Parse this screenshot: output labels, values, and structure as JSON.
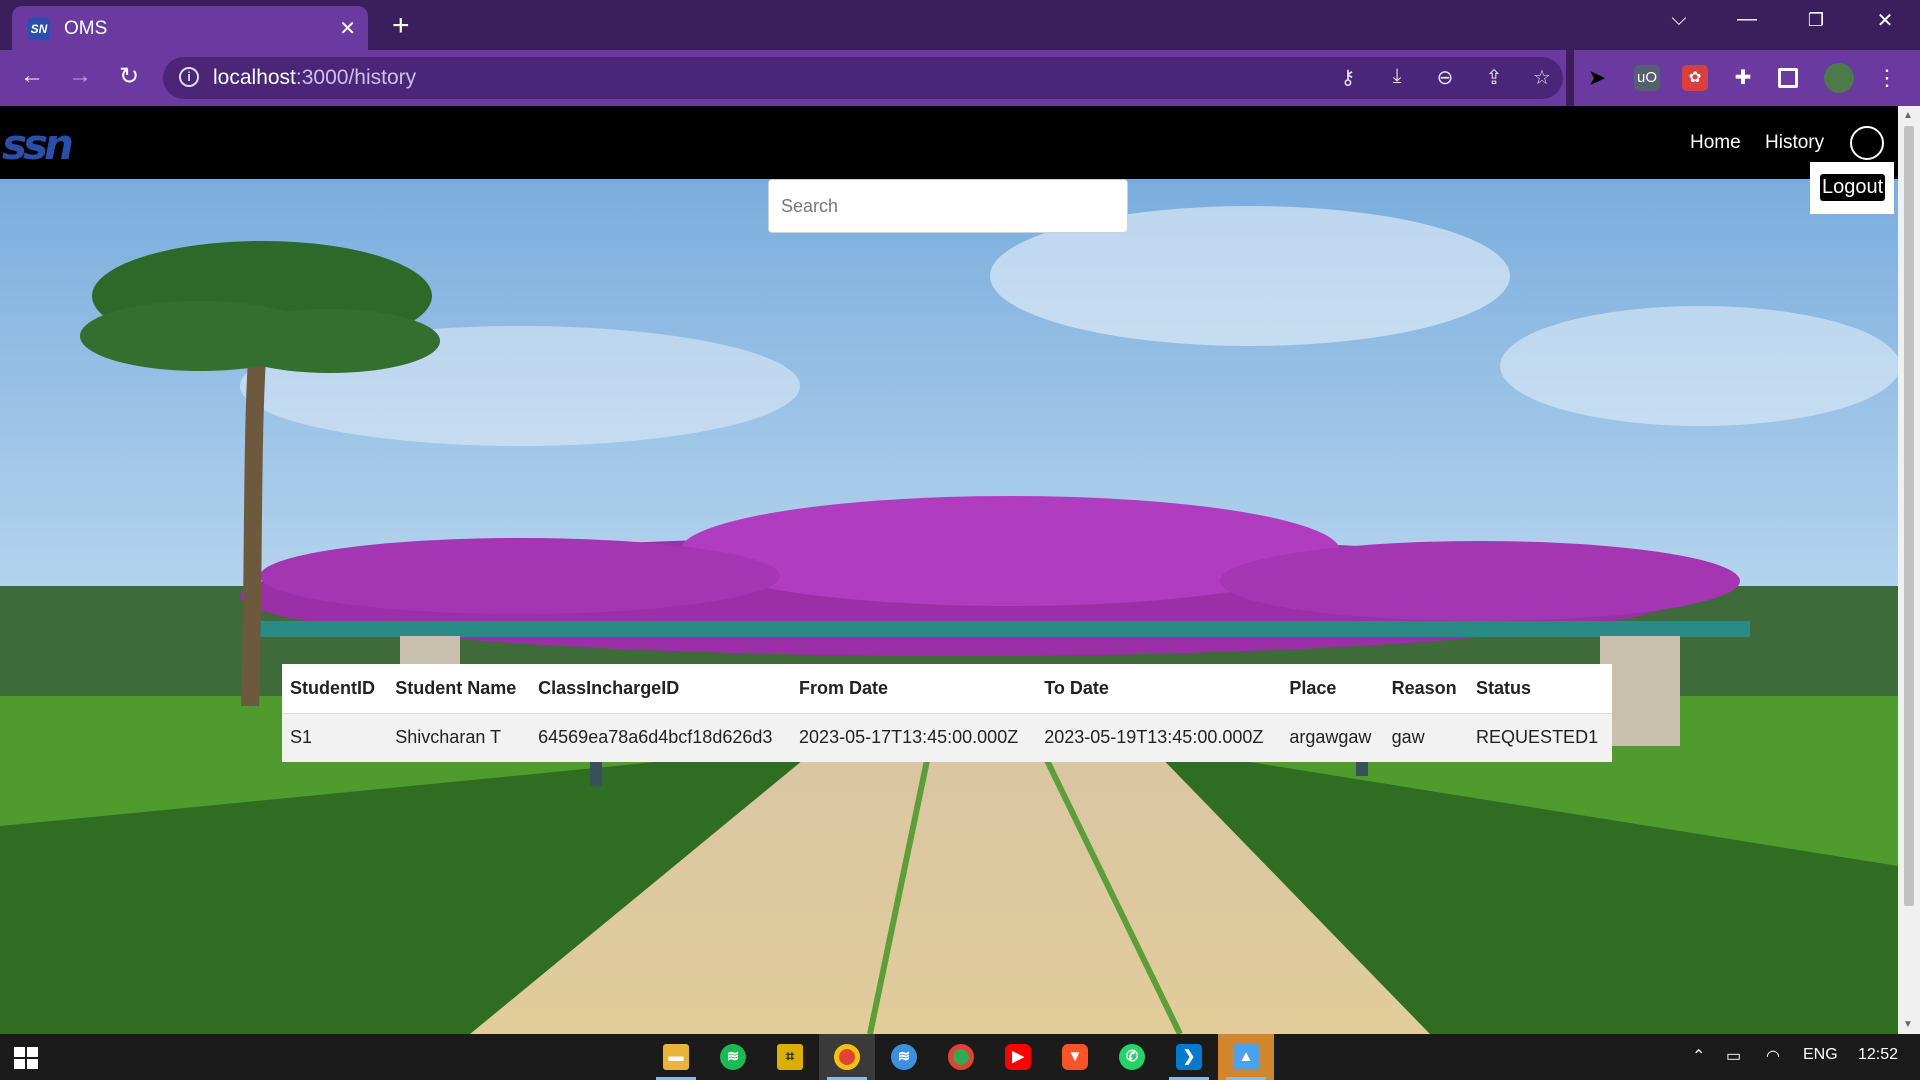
{
  "browser": {
    "tab_title": "OMS",
    "tab_close": "✕",
    "new_tab": "+",
    "url_host": "localhost",
    "url_path": ":3000/history"
  },
  "site": {
    "logo_text": "ssn",
    "nav": {
      "home": "Home",
      "history": "History"
    },
    "logout_label": "Logout"
  },
  "search": {
    "placeholder": "Search",
    "value": ""
  },
  "table": {
    "headers": [
      "StudentID",
      "Student Name",
      "ClassInchargeID",
      "From Date",
      "To Date",
      "Place",
      "Reason",
      "Status"
    ],
    "rows": [
      [
        "S1",
        "Shivcharan T",
        "64569ea78a6d4bcf18d626d3",
        "2023-05-17T13:45:00.000Z",
        "2023-05-19T13:45:00.000Z",
        "argawgaw",
        "gaw",
        "REQUESTED1"
      ]
    ]
  },
  "taskbar": {
    "apps": [
      "file-explorer",
      "spotify",
      "app-manager",
      "chrome-active",
      "spotify-browser",
      "chrome",
      "youtube",
      "brave",
      "whatsapp",
      "vscode",
      "image-viewer"
    ],
    "language": "ENG",
    "time": "12:52"
  },
  "colors": {
    "tab_bar": "#3a1f5c",
    "toolbar": "#6a3aa0",
    "header": "#000000"
  }
}
